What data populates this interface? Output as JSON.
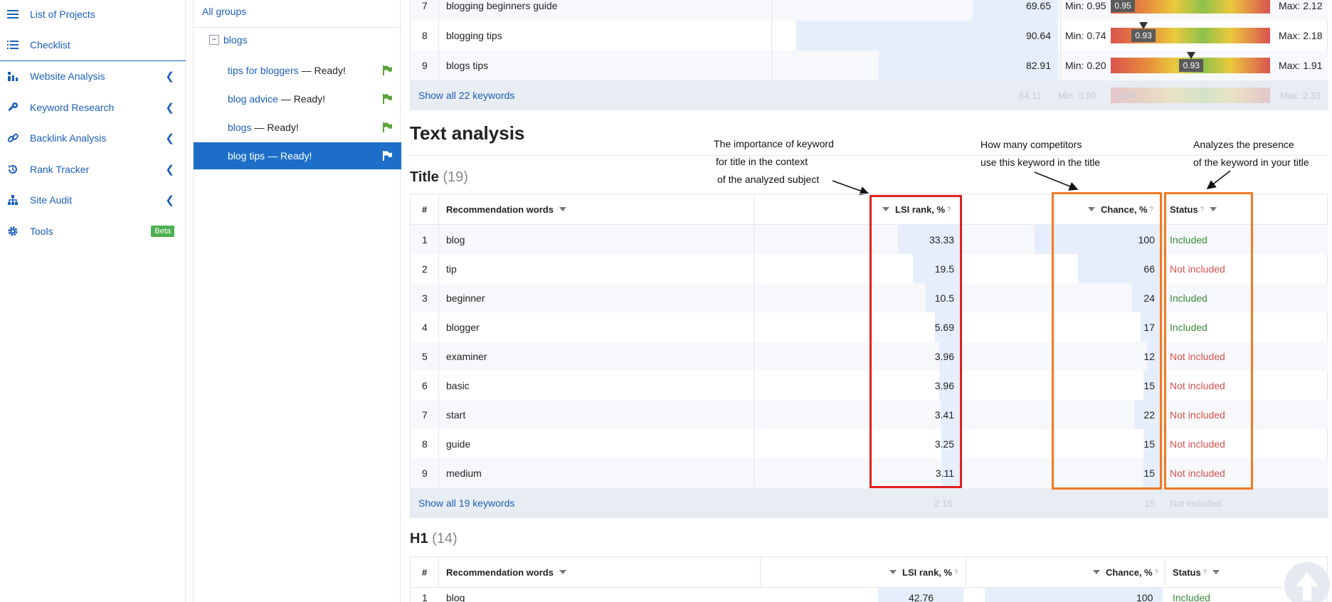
{
  "nav": {
    "items": [
      {
        "label": "List of Projects",
        "icon": "list-icon",
        "chevron": false
      },
      {
        "label": "Checklist",
        "icon": "checklist-icon",
        "chevron": false
      },
      {
        "label": "Website Analysis",
        "icon": "chart-icon",
        "chevron": true
      },
      {
        "label": "Keyword Research",
        "icon": "key-icon",
        "chevron": true
      },
      {
        "label": "Backlink Analysis",
        "icon": "link-icon",
        "chevron": true
      },
      {
        "label": "Rank Tracker",
        "icon": "history-icon",
        "chevron": true
      },
      {
        "label": "Site Audit",
        "icon": "sitemap-icon",
        "chevron": true
      },
      {
        "label": "Tools",
        "icon": "gear-icon",
        "chevron": false,
        "badge": "Beta"
      }
    ]
  },
  "groups": {
    "all_label": "All groups",
    "folder_label": "blogs",
    "folder_toggle": "−",
    "items": [
      {
        "link": "tips for bloggers",
        "status": "— Ready!",
        "active": false
      },
      {
        "link": "blog advice",
        "status": "— Ready!",
        "active": false
      },
      {
        "link": "blogs",
        "status": "— Ready!",
        "active": false
      },
      {
        "link": "blog tips",
        "status": "— Ready!",
        "active": true
      }
    ]
  },
  "top_table": {
    "rows": [
      {
        "n": "7",
        "kw": "blogging beginners guide",
        "score": "69.65",
        "min": "Min: 0.95",
        "pin": "0.95",
        "max": "Max: 2.12",
        "bar": 0.3,
        "pos": 0.0
      },
      {
        "n": "8",
        "kw": "blogging tips",
        "score": "90.64",
        "min": "Min: 0.74",
        "pin": "0.93",
        "max": "Max: 2.18",
        "bar": 0.92,
        "pos": 0.13
      },
      {
        "n": "9",
        "kw": "blogs tips",
        "score": "82.91",
        "min": "Min: 0.20",
        "pin": "0.93",
        "max": "Max: 1.91",
        "bar": 0.63,
        "pos": 0.43
      }
    ],
    "show_all": "Show all 22 keywords",
    "ghost": {
      "score": "84.11",
      "min": "Min: 0.99",
      "pin": "1.00",
      "max": "Max: 2.33"
    }
  },
  "text_analysis": {
    "heading": "Text analysis",
    "annotations": {
      "lsi": [
        "The importance of keyword",
        "for title in the context",
        "of the analyzed subject"
      ],
      "chance": [
        "How many competitors",
        "use this keyword in the title"
      ],
      "status": [
        "Analyzes the presence",
        "of the keyword in your title"
      ]
    },
    "title_section": {
      "label": "Title",
      "count": "(19)",
      "headers": {
        "num": "#",
        "words": "Recommendation words",
        "lsi": "LSI rank, %",
        "chance": "Chance, %",
        "status": "Status",
        "help": "?"
      },
      "rows": [
        {
          "n": "1",
          "word": "blog",
          "lsi": "33.33",
          "lsi_v": 33.33,
          "chance": "100",
          "chance_v": 100,
          "status": "Included",
          "ok": true
        },
        {
          "n": "2",
          "word": "tip",
          "lsi": "19.5",
          "lsi_v": 19.5,
          "chance": "66",
          "chance_v": 66,
          "status": "Not included",
          "ok": false
        },
        {
          "n": "3",
          "word": "beginner",
          "lsi": "10.5",
          "lsi_v": 10.5,
          "chance": "24",
          "chance_v": 24,
          "status": "Included",
          "ok": true
        },
        {
          "n": "4",
          "word": "blogger",
          "lsi": "5.69",
          "lsi_v": 5.69,
          "chance": "17",
          "chance_v": 17,
          "status": "Included",
          "ok": true
        },
        {
          "n": "5",
          "word": "examiner",
          "lsi": "3.96",
          "lsi_v": 3.96,
          "chance": "12",
          "chance_v": 12,
          "status": "Not included",
          "ok": false
        },
        {
          "n": "6",
          "word": "basic",
          "lsi": "3.96",
          "lsi_v": 3.96,
          "chance": "15",
          "chance_v": 15,
          "status": "Not included",
          "ok": false
        },
        {
          "n": "7",
          "word": "start",
          "lsi": "3.41",
          "lsi_v": 3.41,
          "chance": "22",
          "chance_v": 22,
          "status": "Not included",
          "ok": false
        },
        {
          "n": "8",
          "word": "guide",
          "lsi": "3.25",
          "lsi_v": 3.25,
          "chance": "15",
          "chance_v": 15,
          "status": "Not included",
          "ok": false
        },
        {
          "n": "9",
          "word": "medium",
          "lsi": "3.11",
          "lsi_v": 3.11,
          "chance": "15",
          "chance_v": 15,
          "status": "Not included",
          "ok": false
        }
      ],
      "show_all": "Show all 19 keywords",
      "ghost": {
        "lsi": "2.16",
        "chance": "15",
        "status": "Not included"
      }
    },
    "h1_section": {
      "label": "H1",
      "count": "(14)",
      "headers": {
        "num": "#",
        "words": "Recommendation words",
        "lsi": "LSI rank, %",
        "chance": "Chance, %",
        "status": "Status",
        "help": "?"
      },
      "rows": [
        {
          "n": "1",
          "word": "blog",
          "lsi": "42.76",
          "chance": "100",
          "status": "Included"
        }
      ]
    }
  },
  "colors": {
    "primary": "#1c5fb8",
    "active": "#1c6ec8",
    "included": "#3a8a37",
    "not_included": "#d9534f",
    "red_box": "#e01f1f",
    "orange_box": "#f07a22"
  }
}
